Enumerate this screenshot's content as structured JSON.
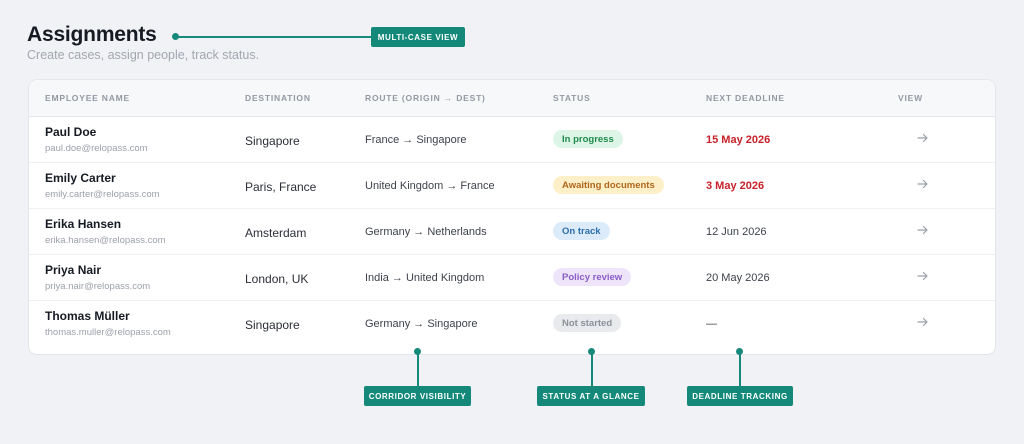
{
  "header": {
    "title": "Assignments",
    "subtitle": "Create cases, assign people, track status."
  },
  "annotations": {
    "top": "MULTI-CASE VIEW",
    "corridor": "CORRIDOR VISIBILITY",
    "status": "STATUS AT A GLANCE",
    "deadline": "DEADLINE TRACKING"
  },
  "table": {
    "columns": [
      "EMPLOYEE NAME",
      "DESTINATION",
      "ROUTE (ORIGIN → DEST)",
      "STATUS",
      "NEXT DEADLINE",
      "VIEW"
    ],
    "rows": [
      {
        "name": "Paul Doe",
        "email": "paul.doe@relopass.com",
        "destination": "Singapore",
        "route": "France → Singapore",
        "status": "In progress",
        "deadline": "15 May 2026"
      },
      {
        "name": "Emily Carter",
        "email": "emily.carter@relopass.com",
        "destination": "Paris, France",
        "route": "United Kingdom → France",
        "status": "Awaiting documents",
        "deadline": "3 May 2026"
      },
      {
        "name": "Erika Hansen",
        "email": "erika.hansen@relopass.com",
        "destination": "Amsterdam",
        "route": "Germany → Netherlands",
        "status": "On track",
        "deadline": "12 Jun 2026"
      },
      {
        "name": "Priya Nair",
        "email": "priya.nair@relopass.com",
        "destination": "London, UK",
        "route": "India → United Kingdom",
        "status": "Policy review",
        "deadline": "20 May 2026"
      },
      {
        "name": "Thomas Müller",
        "email": "thomas.muller@relopass.com",
        "destination": "Singapore",
        "route": "Germany → Singapore",
        "status": "Not started",
        "deadline": "—"
      }
    ]
  },
  "status_styles": {
    "In progress": {
      "bg": "#dcf5e6",
      "fg": "#1f8a4c"
    },
    "Awaiting documents": {
      "bg": "#fdf0c9",
      "fg": "#b0661a"
    },
    "On track": {
      "bg": "#dcebfa",
      "fg": "#2d6ea8"
    },
    "Policy review": {
      "bg": "#efe5fb",
      "fg": "#8a5cc4"
    },
    "Not started": {
      "bg": "#e8eaed",
      "fg": "#8c919a"
    }
  },
  "urgent_deadline_color": "#c8212a",
  "accent_color": "#14897a",
  "view_icon": "arrow-right-icon"
}
